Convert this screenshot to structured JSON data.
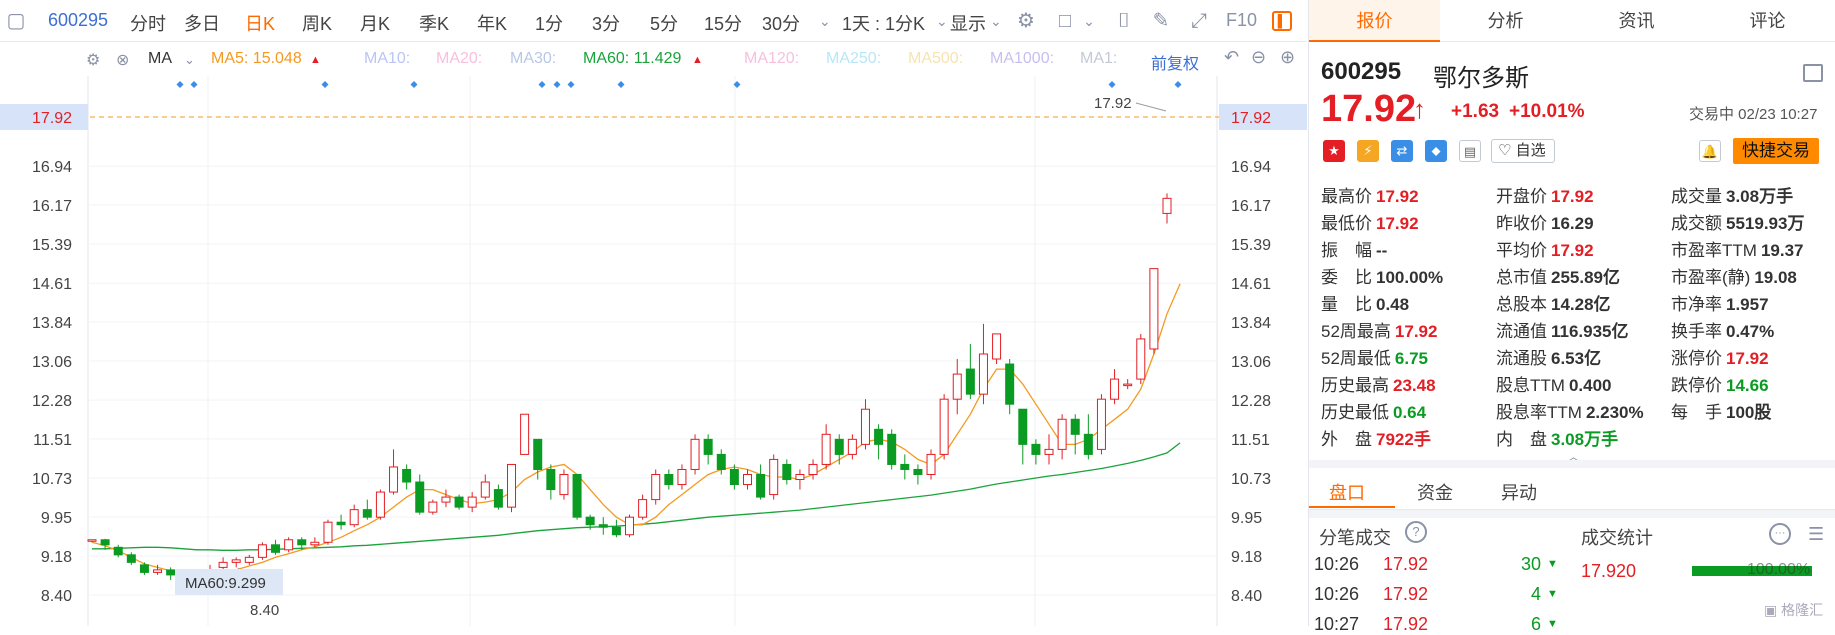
{
  "toolbar": {
    "code": "600295",
    "periods": [
      "分时",
      "多日",
      "日K",
      "周K",
      "月K",
      "季K",
      "年K",
      "1分",
      "3分",
      "5分",
      "15分",
      "30分"
    ],
    "active_period": "日K",
    "multi": "1天 : 1分K",
    "display": "显示",
    "f10": "F10"
  },
  "ma_row": {
    "ma": "MA",
    "ma5": "MA5: 15.048",
    "ma10": "MA10:",
    "ma20": "MA20:",
    "ma30": "MA30:",
    "ma60": "MA60: 11.429",
    "ma120": "MA120:",
    "ma250": "MA250:",
    "ma500": "MA500:",
    "ma1000": "MA1000:",
    "ma1": "MA1:",
    "adjust": "前复权"
  },
  "chart_data": {
    "type": "candlestick",
    "y_ticks": [
      17.92,
      16.94,
      16.17,
      15.39,
      14.61,
      13.84,
      13.06,
      12.28,
      11.51,
      10.73,
      9.95,
      9.18,
      8.4
    ],
    "ylim": [
      8.4,
      17.92
    ],
    "last_price_label": "17.92",
    "high_label": "17.92",
    "low_label": "8.40",
    "tooltip": "MA60:9.299",
    "candles": [
      [
        9.5,
        9.5,
        9.45,
        9.5
      ],
      [
        9.5,
        9.4,
        9.3,
        9.52
      ],
      [
        9.35,
        9.2,
        9.15,
        9.4
      ],
      [
        9.2,
        9.05,
        9.0,
        9.25
      ],
      [
        9.0,
        8.85,
        8.8,
        9.05
      ],
      [
        8.85,
        8.9,
        8.8,
        9.0
      ],
      [
        8.9,
        8.8,
        8.7,
        8.95
      ],
      [
        8.8,
        8.7,
        8.5,
        8.85
      ],
      [
        8.7,
        8.75,
        8.4,
        8.8
      ],
      [
        8.75,
        8.9,
        8.7,
        9.0
      ],
      [
        8.95,
        9.05,
        8.9,
        9.15
      ],
      [
        9.05,
        9.1,
        8.95,
        9.15
      ],
      [
        9.05,
        9.15,
        9.0,
        9.2
      ],
      [
        9.15,
        9.4,
        9.1,
        9.45
      ],
      [
        9.4,
        9.25,
        9.2,
        9.5
      ],
      [
        9.3,
        9.5,
        9.25,
        9.55
      ],
      [
        9.5,
        9.4,
        9.3,
        9.55
      ],
      [
        9.4,
        9.45,
        9.35,
        9.55
      ],
      [
        9.45,
        9.85,
        9.4,
        9.9
      ],
      [
        9.85,
        9.8,
        9.7,
        10.0
      ],
      [
        9.8,
        10.1,
        9.75,
        10.2
      ],
      [
        10.1,
        9.95,
        9.9,
        10.3
      ],
      [
        9.95,
        10.45,
        9.9,
        10.5
      ],
      [
        10.45,
        10.95,
        10.4,
        11.3
      ],
      [
        10.9,
        10.65,
        10.5,
        11.0
      ],
      [
        10.65,
        10.05,
        10.0,
        10.8
      ],
      [
        10.05,
        10.25,
        10.0,
        10.3
      ],
      [
        10.25,
        10.35,
        10.15,
        10.5
      ],
      [
        10.35,
        10.15,
        10.1,
        10.4
      ],
      [
        10.15,
        10.35,
        10.05,
        10.45
      ],
      [
        10.35,
        10.65,
        10.3,
        10.8
      ],
      [
        10.5,
        10.15,
        10.1,
        10.6
      ],
      [
        10.15,
        11.0,
        10.05,
        11.0
      ],
      [
        11.2,
        12.0,
        11.2,
        12.0
      ],
      [
        11.5,
        10.9,
        10.7,
        11.5
      ],
      [
        10.9,
        10.5,
        10.3,
        11.0
      ],
      [
        10.4,
        10.8,
        10.3,
        10.9
      ],
      [
        10.8,
        9.95,
        9.9,
        10.8
      ],
      [
        9.95,
        9.8,
        9.7,
        10.0
      ],
      [
        9.8,
        9.75,
        9.6,
        9.95
      ],
      [
        9.75,
        9.6,
        9.55,
        9.9
      ],
      [
        9.6,
        9.95,
        9.55,
        10.0
      ],
      [
        9.95,
        10.3,
        9.9,
        10.4
      ],
      [
        10.3,
        10.8,
        10.2,
        10.9
      ],
      [
        10.8,
        10.6,
        10.5,
        10.9
      ],
      [
        10.6,
        10.9,
        10.5,
        11.0
      ],
      [
        10.9,
        11.5,
        10.8,
        11.6
      ],
      [
        11.5,
        11.2,
        11.0,
        11.6
      ],
      [
        11.2,
        10.9,
        10.8,
        11.3
      ],
      [
        10.9,
        10.6,
        10.5,
        11.0
      ],
      [
        10.6,
        10.8,
        10.5,
        10.9
      ],
      [
        10.8,
        10.35,
        10.3,
        11.0
      ],
      [
        10.4,
        11.1,
        10.3,
        11.2
      ],
      [
        11.0,
        10.7,
        10.6,
        11.1
      ],
      [
        10.7,
        10.8,
        10.5,
        10.9
      ],
      [
        10.8,
        11.0,
        10.7,
        11.1
      ],
      [
        11.0,
        11.6,
        10.9,
        11.8
      ],
      [
        11.5,
        11.2,
        11.0,
        11.6
      ],
      [
        11.2,
        11.5,
        11.1,
        11.6
      ],
      [
        11.4,
        12.1,
        11.3,
        12.3
      ],
      [
        11.7,
        11.4,
        11.1,
        11.8
      ],
      [
        11.6,
        11.0,
        10.9,
        11.7
      ],
      [
        11.0,
        10.9,
        10.7,
        11.2
      ],
      [
        10.9,
        10.8,
        10.6,
        11.0
      ],
      [
        10.8,
        11.2,
        10.7,
        11.3
      ],
      [
        11.2,
        12.3,
        11.1,
        12.4
      ],
      [
        12.3,
        12.8,
        12.0,
        13.1
      ],
      [
        12.9,
        12.4,
        12.3,
        13.4
      ],
      [
        12.4,
        13.2,
        12.2,
        13.8
      ],
      [
        13.1,
        13.6,
        13.0,
        13.6
      ],
      [
        13.0,
        12.2,
        12.0,
        13.1
      ],
      [
        12.1,
        11.4,
        11.0,
        12.1
      ],
      [
        11.4,
        11.2,
        11.0,
        11.5
      ],
      [
        11.2,
        11.3,
        11.0,
        11.6
      ],
      [
        11.3,
        11.9,
        11.1,
        12.0
      ],
      [
        11.9,
        11.6,
        11.2,
        12.0
      ],
      [
        11.6,
        11.2,
        11.1,
        12.0
      ],
      [
        11.3,
        12.3,
        11.2,
        12.4
      ],
      [
        12.3,
        12.7,
        12.2,
        12.9
      ],
      [
        12.6,
        12.6,
        12.5,
        12.7
      ],
      [
        12.7,
        13.5,
        12.6,
        13.6
      ],
      [
        13.3,
        14.9,
        13.2,
        14.9
      ],
      [
        16.0,
        16.3,
        15.8,
        16.4
      ]
    ],
    "ma5_line": [
      9.45,
      9.38,
      9.28,
      9.15,
      9.02,
      8.95,
      8.88,
      8.82,
      8.78,
      8.78,
      8.84,
      8.9,
      8.98,
      9.05,
      9.15,
      9.22,
      9.3,
      9.36,
      9.45,
      9.55,
      9.68,
      9.8,
      9.95,
      10.15,
      10.35,
      10.5,
      10.5,
      10.4,
      10.3,
      10.22,
      10.25,
      10.3,
      10.45,
      10.7,
      10.85,
      10.95,
      11.0,
      10.8,
      10.5,
      10.2,
      9.95,
      9.8,
      9.8,
      9.95,
      10.2,
      10.4,
      10.6,
      10.8,
      10.9,
      10.95,
      10.9,
      10.8,
      10.75,
      10.75,
      10.7,
      10.8,
      10.95,
      11.1,
      11.25,
      11.45,
      11.5,
      11.45,
      11.3,
      11.1,
      11.0,
      11.2,
      11.6,
      12.0,
      12.5,
      12.9,
      12.9,
      12.6,
      12.2,
      11.8,
      11.4,
      11.4,
      11.5,
      11.7,
      11.9,
      12.1,
      12.5,
      13.2,
      14.0,
      14.6
    ],
    "ma60_line": [
      9.32,
      9.32,
      9.33,
      9.34,
      9.35,
      9.35,
      9.34,
      9.32,
      9.3,
      9.3,
      9.29,
      9.29,
      9.3,
      9.3,
      9.31,
      9.32,
      9.33,
      9.34,
      9.35,
      9.36,
      9.38,
      9.39,
      9.41,
      9.43,
      9.45,
      9.47,
      9.49,
      9.51,
      9.53,
      9.55,
      9.57,
      9.59,
      9.62,
      9.65,
      9.68,
      9.7,
      9.72,
      9.74,
      9.75,
      9.76,
      9.77,
      9.79,
      9.81,
      9.83,
      9.86,
      9.89,
      9.92,
      9.95,
      9.97,
      9.99,
      10.01,
      10.03,
      10.05,
      10.07,
      10.09,
      10.12,
      10.15,
      10.18,
      10.21,
      10.24,
      10.27,
      10.3,
      10.33,
      10.36,
      10.39,
      10.43,
      10.47,
      10.51,
      10.56,
      10.61,
      10.65,
      10.69,
      10.73,
      10.77,
      10.8,
      10.84,
      10.88,
      10.92,
      10.97,
      11.02,
      11.08,
      11.15,
      11.23,
      11.43
    ]
  },
  "quote": {
    "code": "600295",
    "name": "鄂尔多斯",
    "price": "17.92",
    "change": "+1.63",
    "change_pct": "+10.01%",
    "status": "交易中 02/23 10:27",
    "watch": "自选",
    "quick_trade": "快捷交易"
  },
  "right_tabs": [
    "报价",
    "分析",
    "资讯",
    "评论"
  ],
  "stats": [
    [
      "最高价",
      "17.92",
      "red"
    ],
    [
      "开盘价",
      "17.92",
      "red"
    ],
    [
      "成交量",
      "3.08万手",
      "blk"
    ],
    [
      "最低价",
      "17.92",
      "red"
    ],
    [
      "昨收价",
      "16.29",
      "blk"
    ],
    [
      "成交额",
      "5519.93万",
      "blk"
    ],
    [
      "振　幅",
      "--",
      "blk"
    ],
    [
      "平均价",
      "17.92",
      "red"
    ],
    [
      "市盈率TTM",
      "19.37",
      "blk"
    ],
    [
      "委　比",
      "100.00%",
      "blk"
    ],
    [
      "总市值",
      "255.89亿",
      "blk"
    ],
    [
      "市盈率(静)",
      "19.08",
      "blk"
    ],
    [
      "量　比",
      "0.48",
      "blk"
    ],
    [
      "总股本",
      "14.28亿",
      "blk"
    ],
    [
      "市净率",
      "1.957",
      "blk"
    ],
    [
      "52周最高",
      "17.92",
      "red"
    ],
    [
      "流通值",
      "116.935亿",
      "blk"
    ],
    [
      "换手率",
      "0.47%",
      "blk"
    ],
    [
      "52周最低",
      "6.75",
      "grn"
    ],
    [
      "流通股",
      "6.53亿",
      "blk"
    ],
    [
      "涨停价",
      "17.92",
      "red"
    ],
    [
      "历史最高",
      "23.48",
      "red"
    ],
    [
      "股息TTM",
      "0.400",
      "blk"
    ],
    [
      "跌停价",
      "14.66",
      "grn"
    ],
    [
      "历史最低",
      "0.64",
      "grn"
    ],
    [
      "股息率TTM",
      "2.230%",
      "blk"
    ],
    [
      "每　手",
      "100股",
      "blk"
    ],
    [
      "外　盘",
      "7922手",
      "red"
    ],
    [
      "内　盘",
      "3.08万手",
      "grn"
    ]
  ],
  "sub_tabs": [
    "盘口",
    "资金",
    "异动"
  ],
  "trades_title": "分笔成交",
  "trades": [
    {
      "time": "10:26",
      "price": "17.92",
      "vol": "30"
    },
    {
      "time": "10:26",
      "price": "17.92",
      "vol": "4"
    },
    {
      "time": "10:27",
      "price": "17.92",
      "vol": "6"
    }
  ],
  "stat_title": "成交统计",
  "stat_price": "17.920",
  "stat_pct": "100.00%",
  "watermark": "格隆汇"
}
